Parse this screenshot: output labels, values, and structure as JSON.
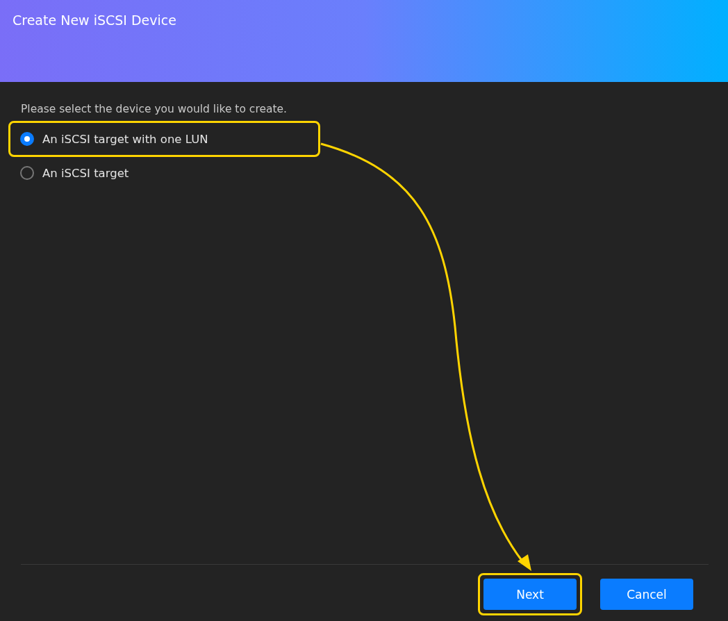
{
  "window": {
    "title": "Create New iSCSI Device"
  },
  "prompt": "Please select the device you would like to create.",
  "options": [
    {
      "label": "An iSCSI target with one LUN",
      "selected": true,
      "highlighted": true
    },
    {
      "label": "An iSCSI target",
      "selected": false,
      "highlighted": false
    }
  ],
  "buttons": [
    {
      "label": "Next",
      "highlighted": true
    },
    {
      "label": "Cancel",
      "highlighted": false
    }
  ]
}
